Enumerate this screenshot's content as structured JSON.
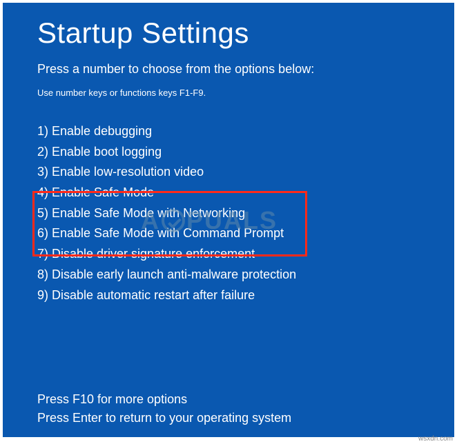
{
  "title": "Startup Settings",
  "subtitle": "Press a number to choose from the options below:",
  "hint": "Use number keys or functions keys F1-F9.",
  "options": [
    "1) Enable debugging",
    "2) Enable boot logging",
    "3) Enable low-resolution video",
    "4) Enable Safe Mode",
    "5) Enable Safe Mode with Networking",
    "6) Enable Safe Mode with Command Prompt",
    "7) Disable driver signature enforcement",
    "8) Disable early launch anti-malware protection",
    "9) Disable automatic restart after failure"
  ],
  "footer": {
    "more": "Press F10 for more options",
    "return": "Press Enter to return to your operating system"
  },
  "watermark": {
    "prefix": "A",
    "suffix": "PUALS"
  },
  "attribution": "wsxdn.com"
}
